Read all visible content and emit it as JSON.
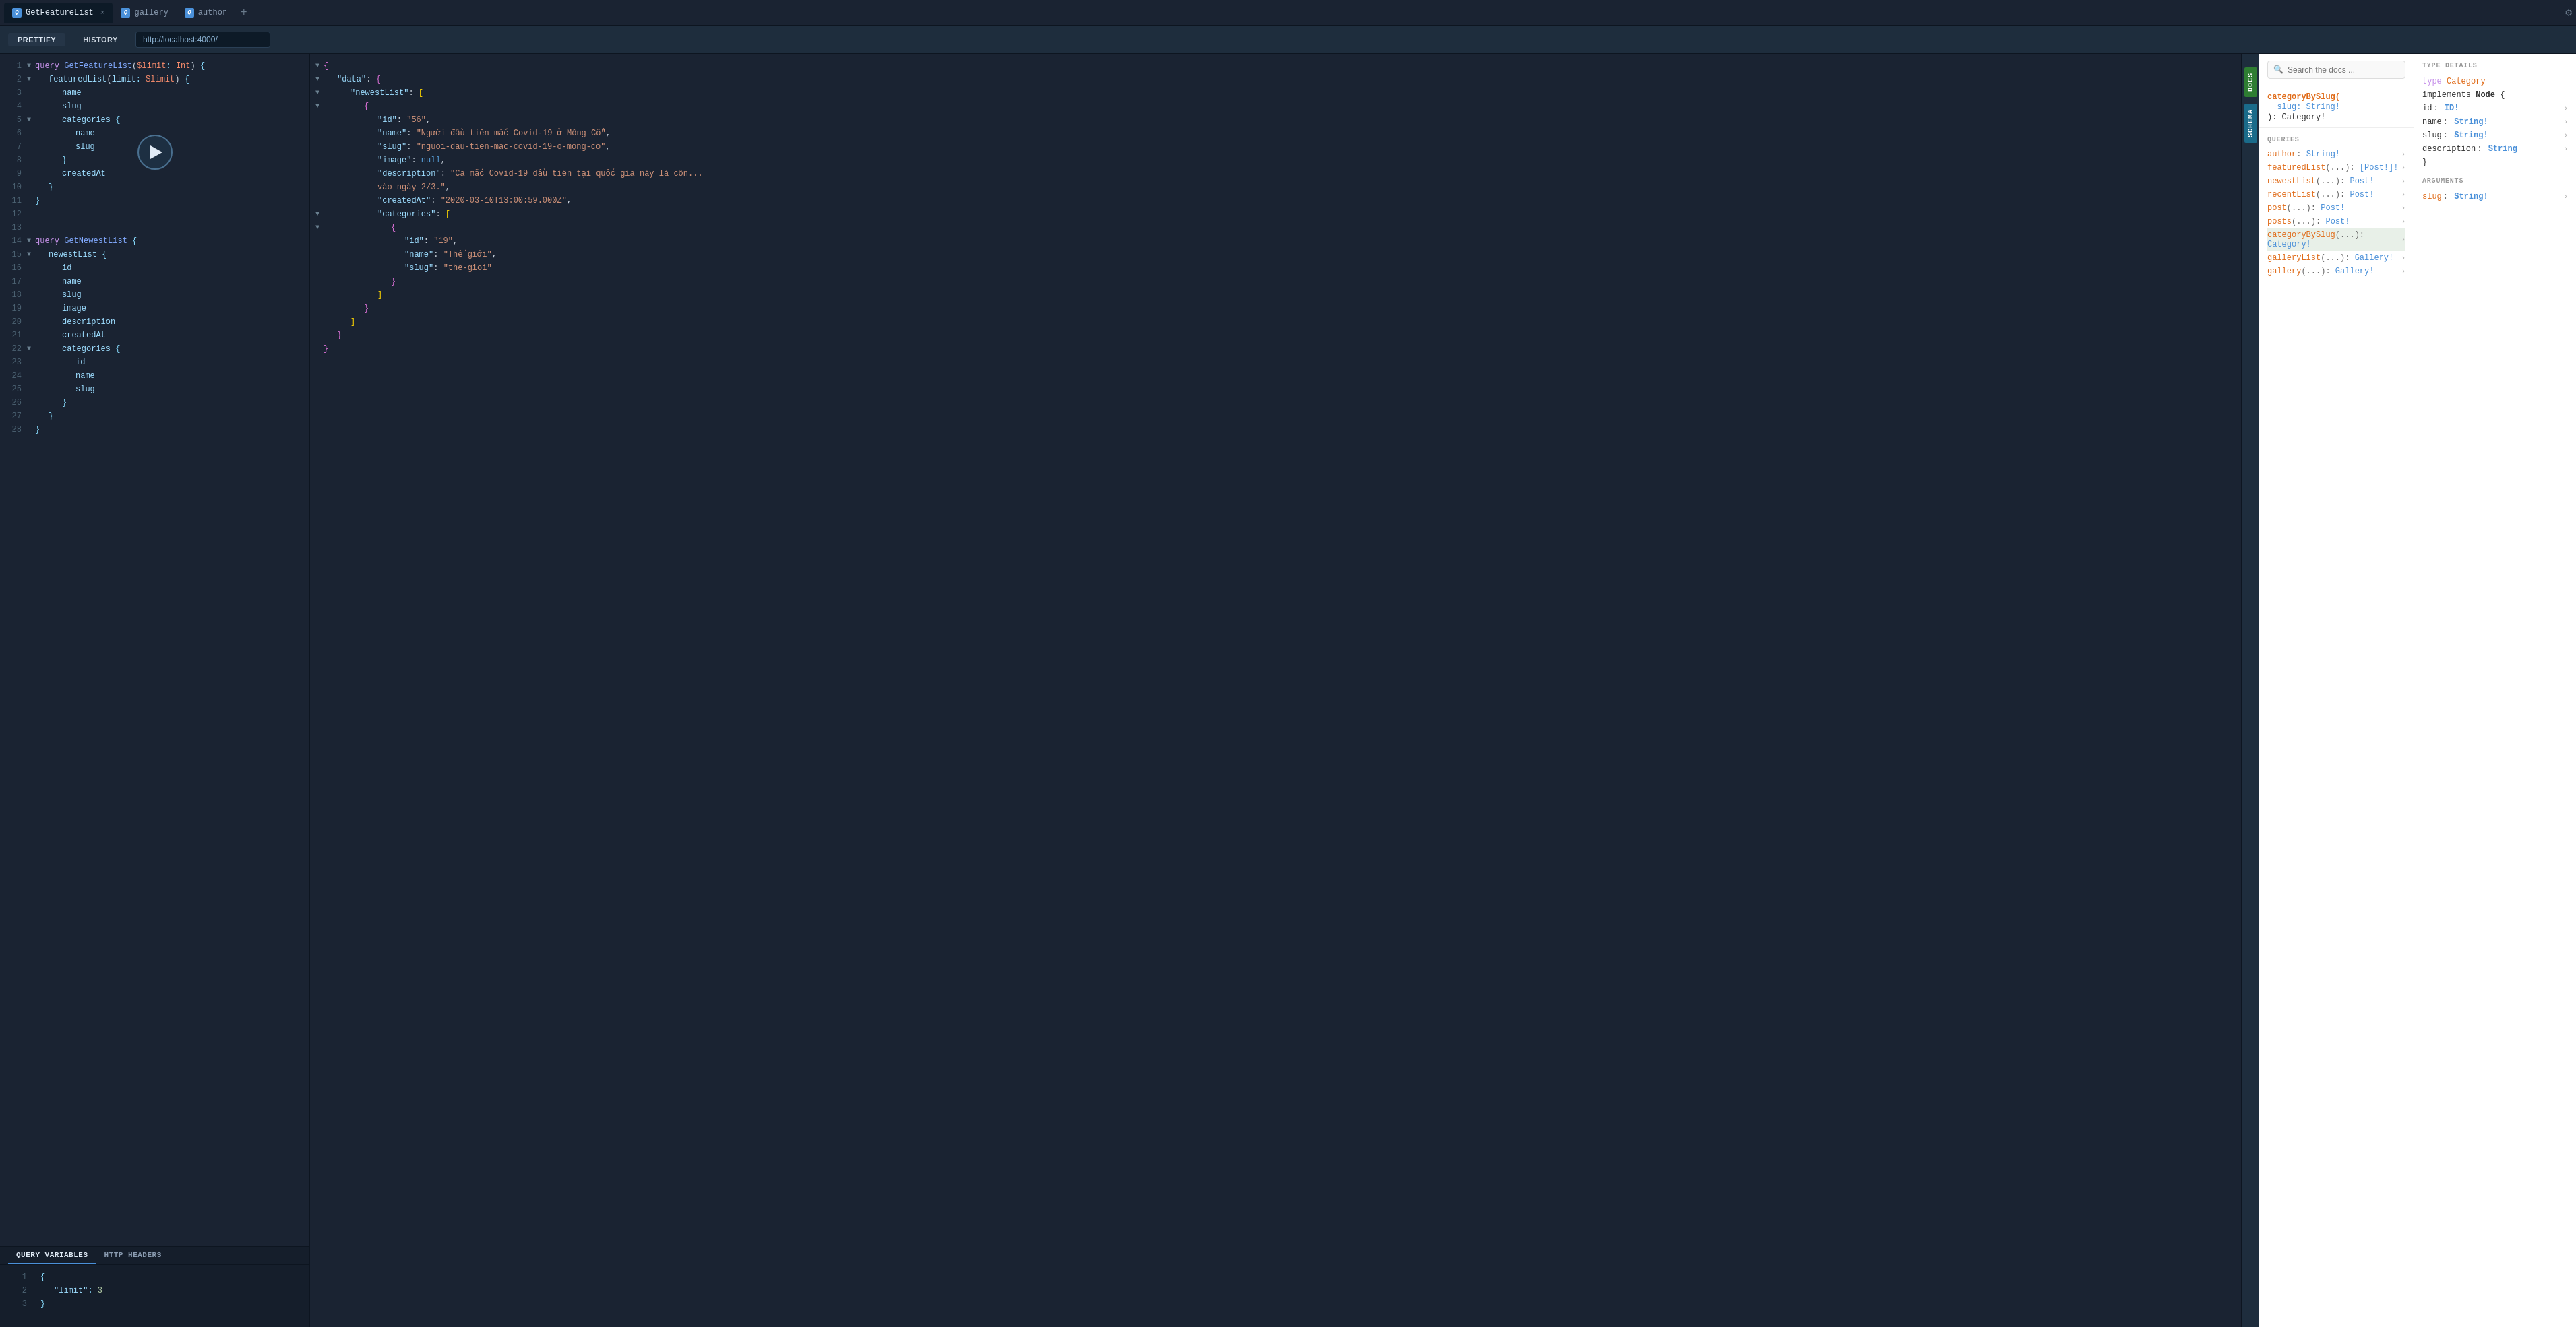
{
  "tabs": [
    {
      "id": "GetFeatureList",
      "label": "GetFeatureList",
      "active": true,
      "closable": true
    },
    {
      "id": "gallery",
      "label": "gallery",
      "active": false,
      "closable": false
    },
    {
      "id": "author",
      "label": "author",
      "active": false,
      "closable": false
    }
  ],
  "toolbar": {
    "prettify_label": "PRETTIFY",
    "history_label": "HISTORY",
    "url": "http://localhost:4000/"
  },
  "editor": {
    "lines": [
      {
        "num": 1,
        "toggle": "▼",
        "indent": 0,
        "content": "query GetFeatureList($limit: Int) {"
      },
      {
        "num": 2,
        "toggle": "▼",
        "indent": 1,
        "content": "featuredList(limit: $limit) {"
      },
      {
        "num": 3,
        "toggle": "",
        "indent": 2,
        "content": "name"
      },
      {
        "num": 4,
        "toggle": "",
        "indent": 2,
        "content": "slug"
      },
      {
        "num": 5,
        "toggle": "▼",
        "indent": 2,
        "content": "categories {"
      },
      {
        "num": 6,
        "toggle": "",
        "indent": 3,
        "content": "name"
      },
      {
        "num": 7,
        "toggle": "",
        "indent": 3,
        "content": "slug"
      },
      {
        "num": 8,
        "toggle": "",
        "indent": 2,
        "content": "}"
      },
      {
        "num": 9,
        "toggle": "",
        "indent": 2,
        "content": "createdAt"
      },
      {
        "num": 10,
        "toggle": "",
        "indent": 1,
        "content": "}"
      },
      {
        "num": 11,
        "toggle": "",
        "indent": 0,
        "content": "}"
      },
      {
        "num": 12,
        "toggle": "",
        "indent": 0,
        "content": ""
      },
      {
        "num": 13,
        "toggle": "",
        "indent": 0,
        "content": ""
      },
      {
        "num": 14,
        "toggle": "▼",
        "indent": 0,
        "content": "query GetNewestList {"
      },
      {
        "num": 15,
        "toggle": "▼",
        "indent": 1,
        "content": "newestList {"
      },
      {
        "num": 16,
        "toggle": "",
        "indent": 2,
        "content": "id"
      },
      {
        "num": 17,
        "toggle": "",
        "indent": 2,
        "content": "name"
      },
      {
        "num": 18,
        "toggle": "",
        "indent": 2,
        "content": "slug"
      },
      {
        "num": 19,
        "toggle": "",
        "indent": 2,
        "content": "image"
      },
      {
        "num": 20,
        "toggle": "",
        "indent": 2,
        "content": "description"
      },
      {
        "num": 21,
        "toggle": "",
        "indent": 2,
        "content": "createdAt"
      },
      {
        "num": 22,
        "toggle": "▼",
        "indent": 2,
        "content": "categories {"
      },
      {
        "num": 23,
        "toggle": "",
        "indent": 3,
        "content": "id"
      },
      {
        "num": 24,
        "toggle": "",
        "indent": 3,
        "content": "name"
      },
      {
        "num": 25,
        "toggle": "",
        "indent": 3,
        "content": "slug"
      },
      {
        "num": 26,
        "toggle": "",
        "indent": 2,
        "content": "}"
      },
      {
        "num": 27,
        "toggle": "",
        "indent": 1,
        "content": "}"
      },
      {
        "num": 28,
        "toggle": "",
        "indent": 0,
        "content": "}"
      }
    ]
  },
  "variables": {
    "query_vars_label": "QUERY VARIABLES",
    "http_headers_label": "HTTP HEADERS",
    "content_lines": [
      {
        "num": 1,
        "content": "{"
      },
      {
        "num": 2,
        "content": "  \"limit\": 3"
      },
      {
        "num": 3,
        "content": "}"
      }
    ]
  },
  "result": {
    "lines": [
      {
        "toggle": "▼",
        "indent": 0,
        "content": "{"
      },
      {
        "toggle": "▼",
        "indent": 1,
        "content": "\"data\": {"
      },
      {
        "toggle": "▼",
        "indent": 2,
        "content": "\"newestList\": ["
      },
      {
        "toggle": "▼",
        "indent": 3,
        "content": "{"
      },
      {
        "toggle": "",
        "indent": 4,
        "content": "\"id\": \"56\","
      },
      {
        "toggle": "",
        "indent": 4,
        "content": "\"name\": \"Người đầu tiên mắc Covid-19 ở Mông Cổ\","
      },
      {
        "toggle": "",
        "indent": 4,
        "content": "\"slug\": \"nguoi-dau-tien-mac-covid-19-o-mong-co\","
      },
      {
        "toggle": "",
        "indent": 4,
        "content": "\"image\": null,"
      },
      {
        "toggle": "",
        "indent": 4,
        "content": "\"description\": \"Ca mắc Covid-19 đầu tiên tại quốc gia này là côn..."
      },
      {
        "toggle": "",
        "indent": 4,
        "content": "vào ngày 2/3.\","
      },
      {
        "toggle": "",
        "indent": 4,
        "content": "\"createdAt\": \"2020-03-10T13:00:59.000Z\","
      },
      {
        "toggle": "▼",
        "indent": 4,
        "content": "\"categories\": ["
      },
      {
        "toggle": "▼",
        "indent": 5,
        "content": "{"
      },
      {
        "toggle": "",
        "indent": 6,
        "content": "\"id\": \"19\","
      },
      {
        "toggle": "",
        "indent": 6,
        "content": "\"name\": \"Thế giới\","
      },
      {
        "toggle": "",
        "indent": 6,
        "content": "\"slug\": \"the-gioi\""
      },
      {
        "toggle": "",
        "indent": 5,
        "content": "}"
      },
      {
        "toggle": "",
        "indent": 4,
        "content": "]"
      },
      {
        "toggle": "",
        "indent": 3,
        "content": "}"
      },
      {
        "toggle": "",
        "indent": 2,
        "content": "]"
      },
      {
        "toggle": "",
        "indent": 1,
        "content": "}"
      },
      {
        "toggle": "",
        "indent": 0,
        "content": "}"
      }
    ]
  },
  "side_tabs": [
    {
      "id": "docs",
      "label": "DOCS",
      "color": "#2e7d32"
    },
    {
      "id": "schema",
      "label": "SCHEMA",
      "color": "#1a6b8a"
    }
  ],
  "docs": {
    "search_placeholder": "Search the docs ...",
    "breadcrumb": {
      "category": "categoryBySlug(",
      "args": "slug: String!",
      "return": "): Category!"
    },
    "queries_title": "QUERIES",
    "queries": [
      {
        "name": "author",
        "args": "",
        "return": "String!",
        "selected": false
      },
      {
        "name": "featuredList",
        "args": "(...)",
        "return": "[Post!]!",
        "selected": false
      },
      {
        "name": "newestList",
        "args": "(...)",
        "return": "Post!",
        "selected": false
      },
      {
        "name": "recentList",
        "args": "(...)",
        "return": "Post!",
        "selected": false
      },
      {
        "name": "post",
        "args": "(...)",
        "return": "Post!",
        "selected": false
      },
      {
        "name": "posts",
        "args": "(...)",
        "return": "Post!",
        "selected": false
      },
      {
        "name": "categoryBySlug",
        "args": "(...)",
        "return": "Category!",
        "selected": true
      },
      {
        "name": "galleryList",
        "args": "(...)",
        "return": "Gallery!",
        "selected": false
      },
      {
        "name": "gallery",
        "args": "(...)",
        "return": "Gallery!",
        "selected": false
      }
    ]
  },
  "type_details": {
    "section_title": "TYPE DETAILS",
    "type_def": {
      "keyword": "type",
      "name": "Category"
    },
    "implements": "implements Node {",
    "fields": [
      {
        "name": "id",
        "type": "ID!",
        "has_chevron": true
      },
      {
        "name": "name",
        "type": "String!",
        "has_chevron": true
      },
      {
        "name": "slug",
        "type": "String!",
        "has_chevron": true
      },
      {
        "name": "description",
        "type": "String",
        "has_chevron": true
      }
    ],
    "closing": "}",
    "arguments_title": "ARGUMENTS",
    "arguments": [
      {
        "name": "slug",
        "type": "String!",
        "has_chevron": true
      }
    ]
  }
}
